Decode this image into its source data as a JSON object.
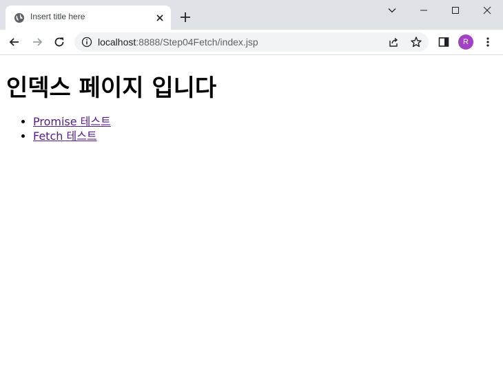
{
  "tab": {
    "title": "Insert title here",
    "favicon": "globe-icon",
    "close": "close-icon"
  },
  "window_controls": [
    "tab-search-icon",
    "minimize-icon",
    "maximize-icon",
    "close-icon"
  ],
  "toolbar": {
    "back": "back-arrow-icon",
    "forward": "forward-arrow-icon",
    "reload": "reload-icon",
    "site_info": "info-icon",
    "url_host": "localhost",
    "url_rest": ":8888/Step04Fetch/index.jsp",
    "share": "share-icon",
    "bookmark": "star-icon",
    "side_panel": "side-panel-icon",
    "profile_initial": "R",
    "menu": "kebab-menu-icon"
  },
  "page": {
    "heading": "인덱스 페이지 입니다",
    "links": [
      {
        "label": "Promise 테스트"
      },
      {
        "label": "Fetch 테스트"
      }
    ]
  },
  "colors": {
    "titlebar": "#dee1e6",
    "omnibox": "#f1f3f4",
    "visited_link": "#551a8b",
    "avatar": "#a142c4"
  }
}
